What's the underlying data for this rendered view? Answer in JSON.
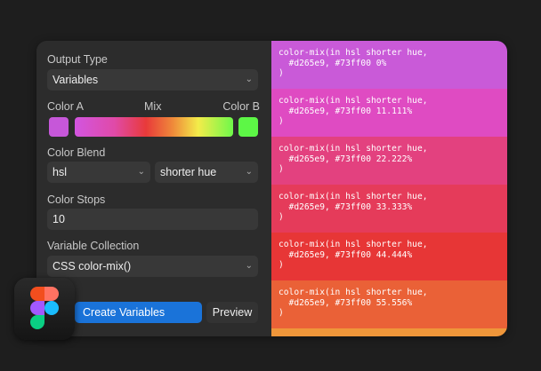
{
  "output_type": {
    "label": "Output Type",
    "value": "Variables"
  },
  "mix": {
    "color_a_label": "Color A",
    "mix_label": "Mix",
    "color_b_label": "Color B",
    "color_a": "#d265e9",
    "color_b": "#73ff00"
  },
  "blend": {
    "label": "Color Blend",
    "space": "hsl",
    "hue": "shorter hue"
  },
  "stops": {
    "label": "Color Stops",
    "value": "10"
  },
  "collection": {
    "label": "Variable Collection",
    "value": "CSS color-mix()"
  },
  "buttons": {
    "create": "Create Variables",
    "preview": "Preview"
  },
  "preview_blocks": [
    {
      "text": "color-mix(in hsl shorter hue,\n  #d265e9, #73ff00 0%\n)",
      "color": "#c95ad8"
    },
    {
      "text": "color-mix(in hsl shorter hue,\n  #d265e9, #73ff00 11.111%\n)",
      "color": "#df4bc2"
    },
    {
      "text": "color-mix(in hsl shorter hue,\n  #d265e9, #73ff00 22.222%\n)",
      "color": "#e3417f"
    },
    {
      "text": "color-mix(in hsl shorter hue,\n  #d265e9, #73ff00 33.333%\n)",
      "color": "#e53b5a"
    },
    {
      "text": "color-mix(in hsl shorter hue,\n  #d265e9, #73ff00 44.444%\n)",
      "color": "#e73636"
    },
    {
      "text": "color-mix(in hsl shorter hue,\n  #d265e9, #73ff00 55.556%\n)",
      "color": "#ea6137"
    }
  ],
  "next_block_color": "#ef963a"
}
